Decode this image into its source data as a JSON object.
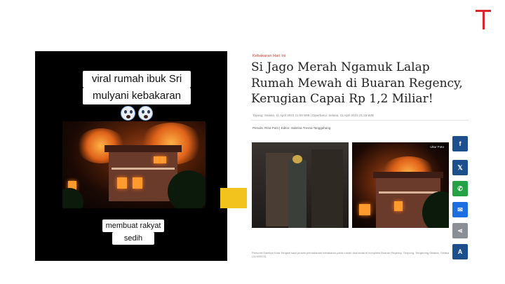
{
  "brand": {
    "logo": "T",
    "color": "#d8262a"
  },
  "video": {
    "caption_top_line1": "viral rumah ibuk Sri",
    "caption_top_line2": "mulyani kebakaran",
    "caption_emoji": [
      "face-screaming-icon",
      "face-screaming-icon"
    ],
    "caption_bottom_line1": "membuat rakyat",
    "caption_bottom_line2": "sedih"
  },
  "arrow": {
    "color": "#f2c31c"
  },
  "article": {
    "kicker": "Kebakaran Hari Ini",
    "headline": "Si Jago Merah Ngamuk Lalap Rumah Mewah di Buaran Regency, Kerugian Capai Rp 1,2 Miliar!",
    "meta": "Tayang: Selasa, 11 April 2023 21:09 WIB | Diperbarui: Selasa, 11 April 2023 21:15 WIB",
    "byline": "Penulis: Rina Putri | Editor: Sabrina Tresna Tanggahang",
    "fullsize_label": "Ukur Foto",
    "photo_caption": "Personel Damkar Kota Tangsel saat proses pemadaman kebakaran pada rumah dua lantai di kompleks Buaran Regency, Serpong, Tangerang Selatan, Selasa (11/4/2023).",
    "share": [
      {
        "name": "facebook",
        "glyph": "f"
      },
      {
        "name": "x",
        "glyph": "𝕏"
      },
      {
        "name": "whatsapp",
        "glyph": "✆"
      },
      {
        "name": "messenger",
        "glyph": "✉"
      },
      {
        "name": "share",
        "glyph": "⋖"
      },
      {
        "name": "font-size",
        "glyph": "A"
      }
    ]
  }
}
